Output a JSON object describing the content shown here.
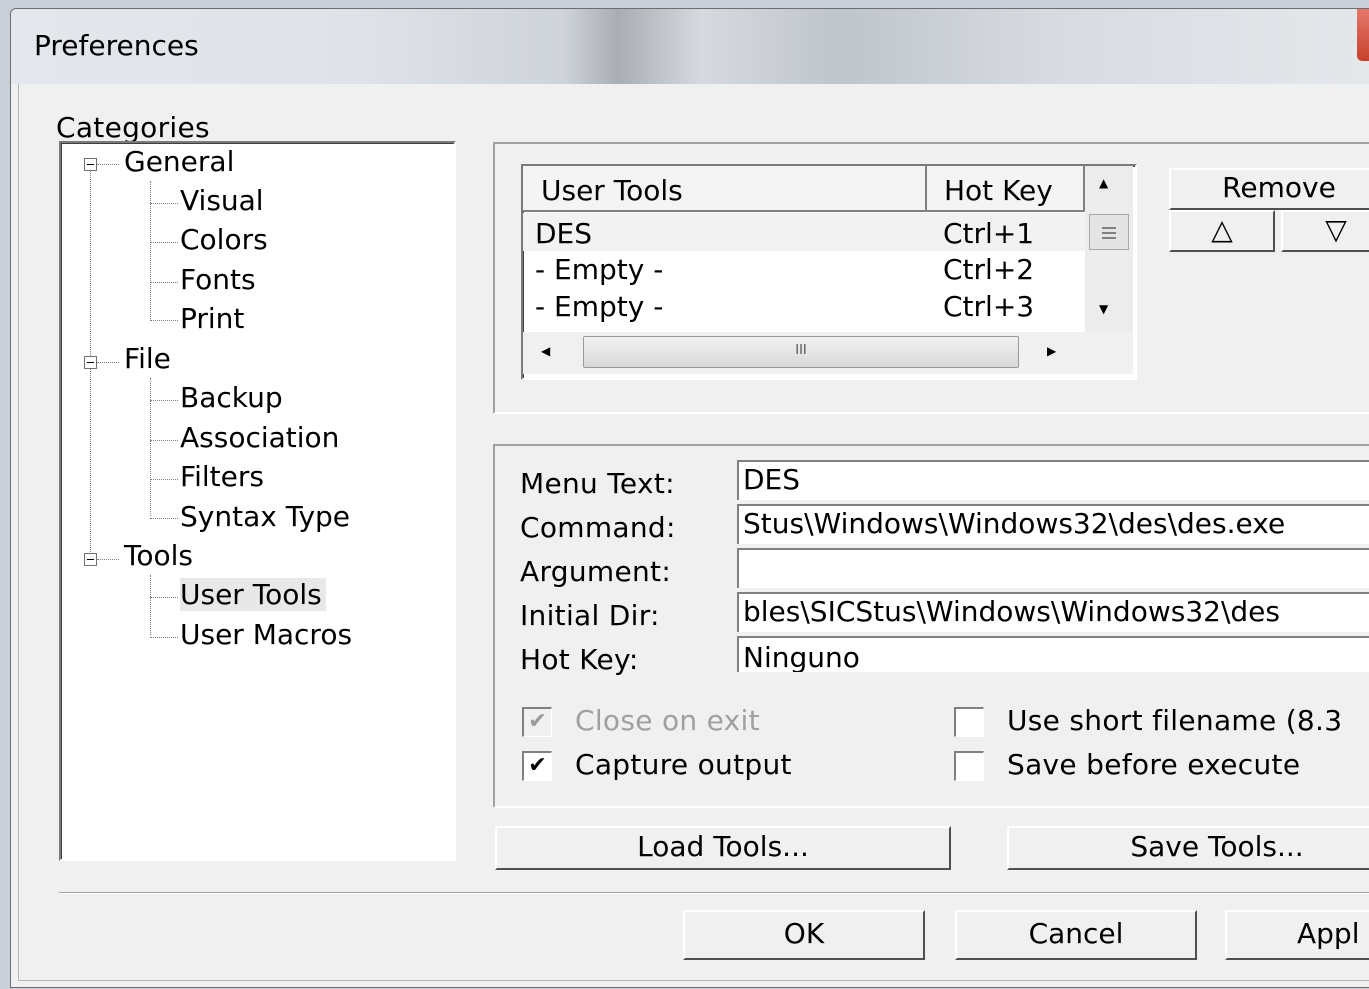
{
  "window": {
    "title": "Preferences"
  },
  "categories": {
    "label": "Categories",
    "tree": [
      {
        "label": "General",
        "children": [
          "Visual",
          "Colors",
          "Fonts",
          "Print"
        ]
      },
      {
        "label": "File",
        "children": [
          "Backup",
          "Association",
          "Filters",
          "Syntax Type"
        ]
      },
      {
        "label": "Tools",
        "children": [
          "User Tools",
          "User Macros"
        ]
      }
    ],
    "selected": "User Tools"
  },
  "tools_list": {
    "columns": [
      "User Tools",
      "Hot Key"
    ],
    "rows": [
      {
        "name": "DES",
        "hotkey": "Ctrl+1"
      },
      {
        "name": "- Empty -",
        "hotkey": "Ctrl+2"
      },
      {
        "name": "- Empty -",
        "hotkey": "Ctrl+3"
      }
    ],
    "hscroll_grip": "III"
  },
  "buttons": {
    "remove": "Remove",
    "move_up": "△",
    "move_down": "▽",
    "load_tools": "Load Tools...",
    "save_tools": "Save Tools...",
    "ok": "OK",
    "cancel": "Cancel",
    "apply": "Appl"
  },
  "form": {
    "menu_text_label": "Menu Text:",
    "menu_text_value": "DES",
    "command_label": "Command:",
    "command_value": "Stus\\Windows\\Windows32\\des\\des.exe",
    "argument_label": "Argument:",
    "argument_value": "",
    "initial_dir_label": "Initial Dir:",
    "initial_dir_value": "bles\\SICStus\\Windows\\Windows32\\des",
    "hot_key_label": "Hot Key:",
    "hot_key_value": "Ninguno"
  },
  "options": {
    "close_on_exit": {
      "label": "Close on exit",
      "checked": true,
      "enabled": false
    },
    "capture_output": {
      "label": "Capture output",
      "checked": true,
      "enabled": true
    },
    "use_short_filename": {
      "label": "Use short filename (8.3",
      "checked": false,
      "enabled": true
    },
    "save_before_execute": {
      "label": "Save before execute",
      "checked": false,
      "enabled": true
    }
  },
  "icons": {
    "check": "✔",
    "scroll_up": "▲",
    "scroll_down": "▼",
    "scroll_left": "◀",
    "scroll_right": "▶"
  }
}
